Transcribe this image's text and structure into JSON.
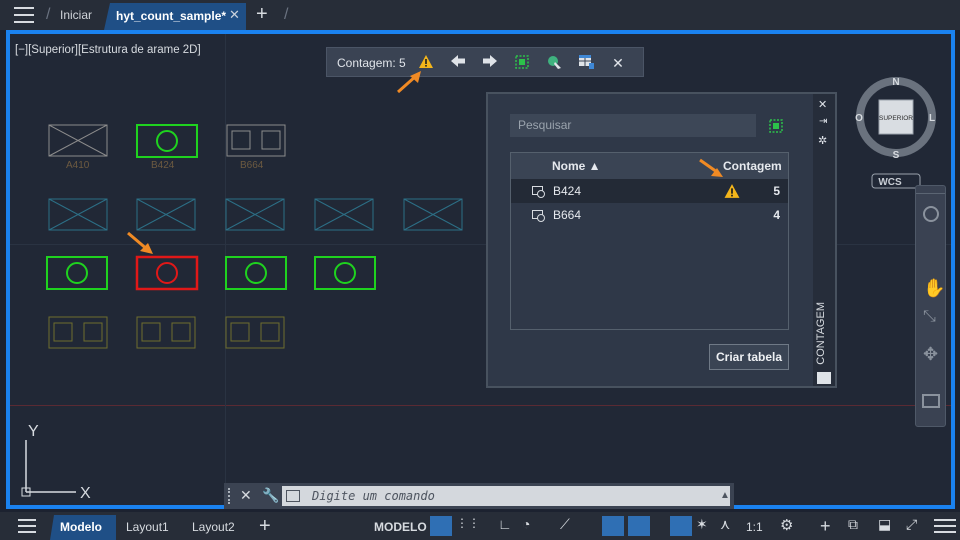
{
  "topbar": {
    "home_tab": "Iniciar",
    "file_tab": "hyt_count_sample*",
    "close_glyph": "✕",
    "plus_glyph": "+"
  },
  "viewport": {
    "view_label": "[−][Superior][Estrutura de arame 2D]"
  },
  "count_toolbar": {
    "label": "Contagem:",
    "count": "5",
    "close_glyph": "✕"
  },
  "blocks": {
    "labels": [
      "A410",
      "B424",
      "B664"
    ]
  },
  "count_panel": {
    "search_placeholder": "Pesquisar",
    "col_name": "Nome ▲",
    "col_count": "Contagem",
    "rows": [
      {
        "name": "B424",
        "count": "5",
        "warning": true
      },
      {
        "name": "B664",
        "count": "4",
        "warning": false
      }
    ],
    "create_table": "Criar tabela",
    "side_title": "CONTAGEM"
  },
  "viewcube": {
    "north": "N",
    "south": "S",
    "east": "L",
    "west": "O",
    "face": "SUPERIOR",
    "wcs": "WCS"
  },
  "ucs": {
    "x": "X",
    "y": "Y"
  },
  "command": {
    "placeholder": "Digite um comando"
  },
  "statusbar": {
    "model_tab": "Modelo",
    "layout1": "Layout1",
    "layout2": "Layout2",
    "model_space": "MODELO",
    "scale": "1:1"
  },
  "colors": {
    "accent_blue": "#1a82f0",
    "warning": "#f3b51b",
    "arrow_orange": "#f08a24",
    "block_green": "#1fd21f",
    "block_red": "#e01818",
    "block_gray": "#8c8c8c",
    "block_teal": "#2c6f86",
    "block_olive": "#6e6e2e"
  }
}
